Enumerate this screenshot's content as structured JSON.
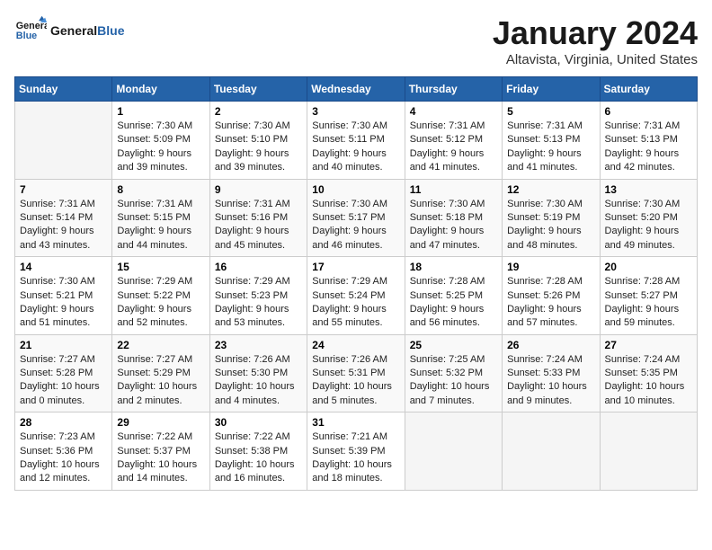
{
  "header": {
    "logo_line1": "General",
    "logo_line2": "Blue",
    "month": "January 2024",
    "location": "Altavista, Virginia, United States"
  },
  "days_of_week": [
    "Sunday",
    "Monday",
    "Tuesday",
    "Wednesday",
    "Thursday",
    "Friday",
    "Saturday"
  ],
  "weeks": [
    [
      {
        "day": null,
        "data": null
      },
      {
        "day": "1",
        "data": "Sunrise: 7:30 AM\nSunset: 5:09 PM\nDaylight: 9 hours and 39 minutes."
      },
      {
        "day": "2",
        "data": "Sunrise: 7:30 AM\nSunset: 5:10 PM\nDaylight: 9 hours and 39 minutes."
      },
      {
        "day": "3",
        "data": "Sunrise: 7:30 AM\nSunset: 5:11 PM\nDaylight: 9 hours and 40 minutes."
      },
      {
        "day": "4",
        "data": "Sunrise: 7:31 AM\nSunset: 5:12 PM\nDaylight: 9 hours and 41 minutes."
      },
      {
        "day": "5",
        "data": "Sunrise: 7:31 AM\nSunset: 5:13 PM\nDaylight: 9 hours and 41 minutes."
      },
      {
        "day": "6",
        "data": "Sunrise: 7:31 AM\nSunset: 5:13 PM\nDaylight: 9 hours and 42 minutes."
      }
    ],
    [
      {
        "day": "7",
        "data": "Sunrise: 7:31 AM\nSunset: 5:14 PM\nDaylight: 9 hours and 43 minutes."
      },
      {
        "day": "8",
        "data": "Sunrise: 7:31 AM\nSunset: 5:15 PM\nDaylight: 9 hours and 44 minutes."
      },
      {
        "day": "9",
        "data": "Sunrise: 7:31 AM\nSunset: 5:16 PM\nDaylight: 9 hours and 45 minutes."
      },
      {
        "day": "10",
        "data": "Sunrise: 7:30 AM\nSunset: 5:17 PM\nDaylight: 9 hours and 46 minutes."
      },
      {
        "day": "11",
        "data": "Sunrise: 7:30 AM\nSunset: 5:18 PM\nDaylight: 9 hours and 47 minutes."
      },
      {
        "day": "12",
        "data": "Sunrise: 7:30 AM\nSunset: 5:19 PM\nDaylight: 9 hours and 48 minutes."
      },
      {
        "day": "13",
        "data": "Sunrise: 7:30 AM\nSunset: 5:20 PM\nDaylight: 9 hours and 49 minutes."
      }
    ],
    [
      {
        "day": "14",
        "data": "Sunrise: 7:30 AM\nSunset: 5:21 PM\nDaylight: 9 hours and 51 minutes."
      },
      {
        "day": "15",
        "data": "Sunrise: 7:29 AM\nSunset: 5:22 PM\nDaylight: 9 hours and 52 minutes."
      },
      {
        "day": "16",
        "data": "Sunrise: 7:29 AM\nSunset: 5:23 PM\nDaylight: 9 hours and 53 minutes."
      },
      {
        "day": "17",
        "data": "Sunrise: 7:29 AM\nSunset: 5:24 PM\nDaylight: 9 hours and 55 minutes."
      },
      {
        "day": "18",
        "data": "Sunrise: 7:28 AM\nSunset: 5:25 PM\nDaylight: 9 hours and 56 minutes."
      },
      {
        "day": "19",
        "data": "Sunrise: 7:28 AM\nSunset: 5:26 PM\nDaylight: 9 hours and 57 minutes."
      },
      {
        "day": "20",
        "data": "Sunrise: 7:28 AM\nSunset: 5:27 PM\nDaylight: 9 hours and 59 minutes."
      }
    ],
    [
      {
        "day": "21",
        "data": "Sunrise: 7:27 AM\nSunset: 5:28 PM\nDaylight: 10 hours and 0 minutes."
      },
      {
        "day": "22",
        "data": "Sunrise: 7:27 AM\nSunset: 5:29 PM\nDaylight: 10 hours and 2 minutes."
      },
      {
        "day": "23",
        "data": "Sunrise: 7:26 AM\nSunset: 5:30 PM\nDaylight: 10 hours and 4 minutes."
      },
      {
        "day": "24",
        "data": "Sunrise: 7:26 AM\nSunset: 5:31 PM\nDaylight: 10 hours and 5 minutes."
      },
      {
        "day": "25",
        "data": "Sunrise: 7:25 AM\nSunset: 5:32 PM\nDaylight: 10 hours and 7 minutes."
      },
      {
        "day": "26",
        "data": "Sunrise: 7:24 AM\nSunset: 5:33 PM\nDaylight: 10 hours and 9 minutes."
      },
      {
        "day": "27",
        "data": "Sunrise: 7:24 AM\nSunset: 5:35 PM\nDaylight: 10 hours and 10 minutes."
      }
    ],
    [
      {
        "day": "28",
        "data": "Sunrise: 7:23 AM\nSunset: 5:36 PM\nDaylight: 10 hours and 12 minutes."
      },
      {
        "day": "29",
        "data": "Sunrise: 7:22 AM\nSunset: 5:37 PM\nDaylight: 10 hours and 14 minutes."
      },
      {
        "day": "30",
        "data": "Sunrise: 7:22 AM\nSunset: 5:38 PM\nDaylight: 10 hours and 16 minutes."
      },
      {
        "day": "31",
        "data": "Sunrise: 7:21 AM\nSunset: 5:39 PM\nDaylight: 10 hours and 18 minutes."
      },
      {
        "day": null,
        "data": null
      },
      {
        "day": null,
        "data": null
      },
      {
        "day": null,
        "data": null
      }
    ]
  ]
}
